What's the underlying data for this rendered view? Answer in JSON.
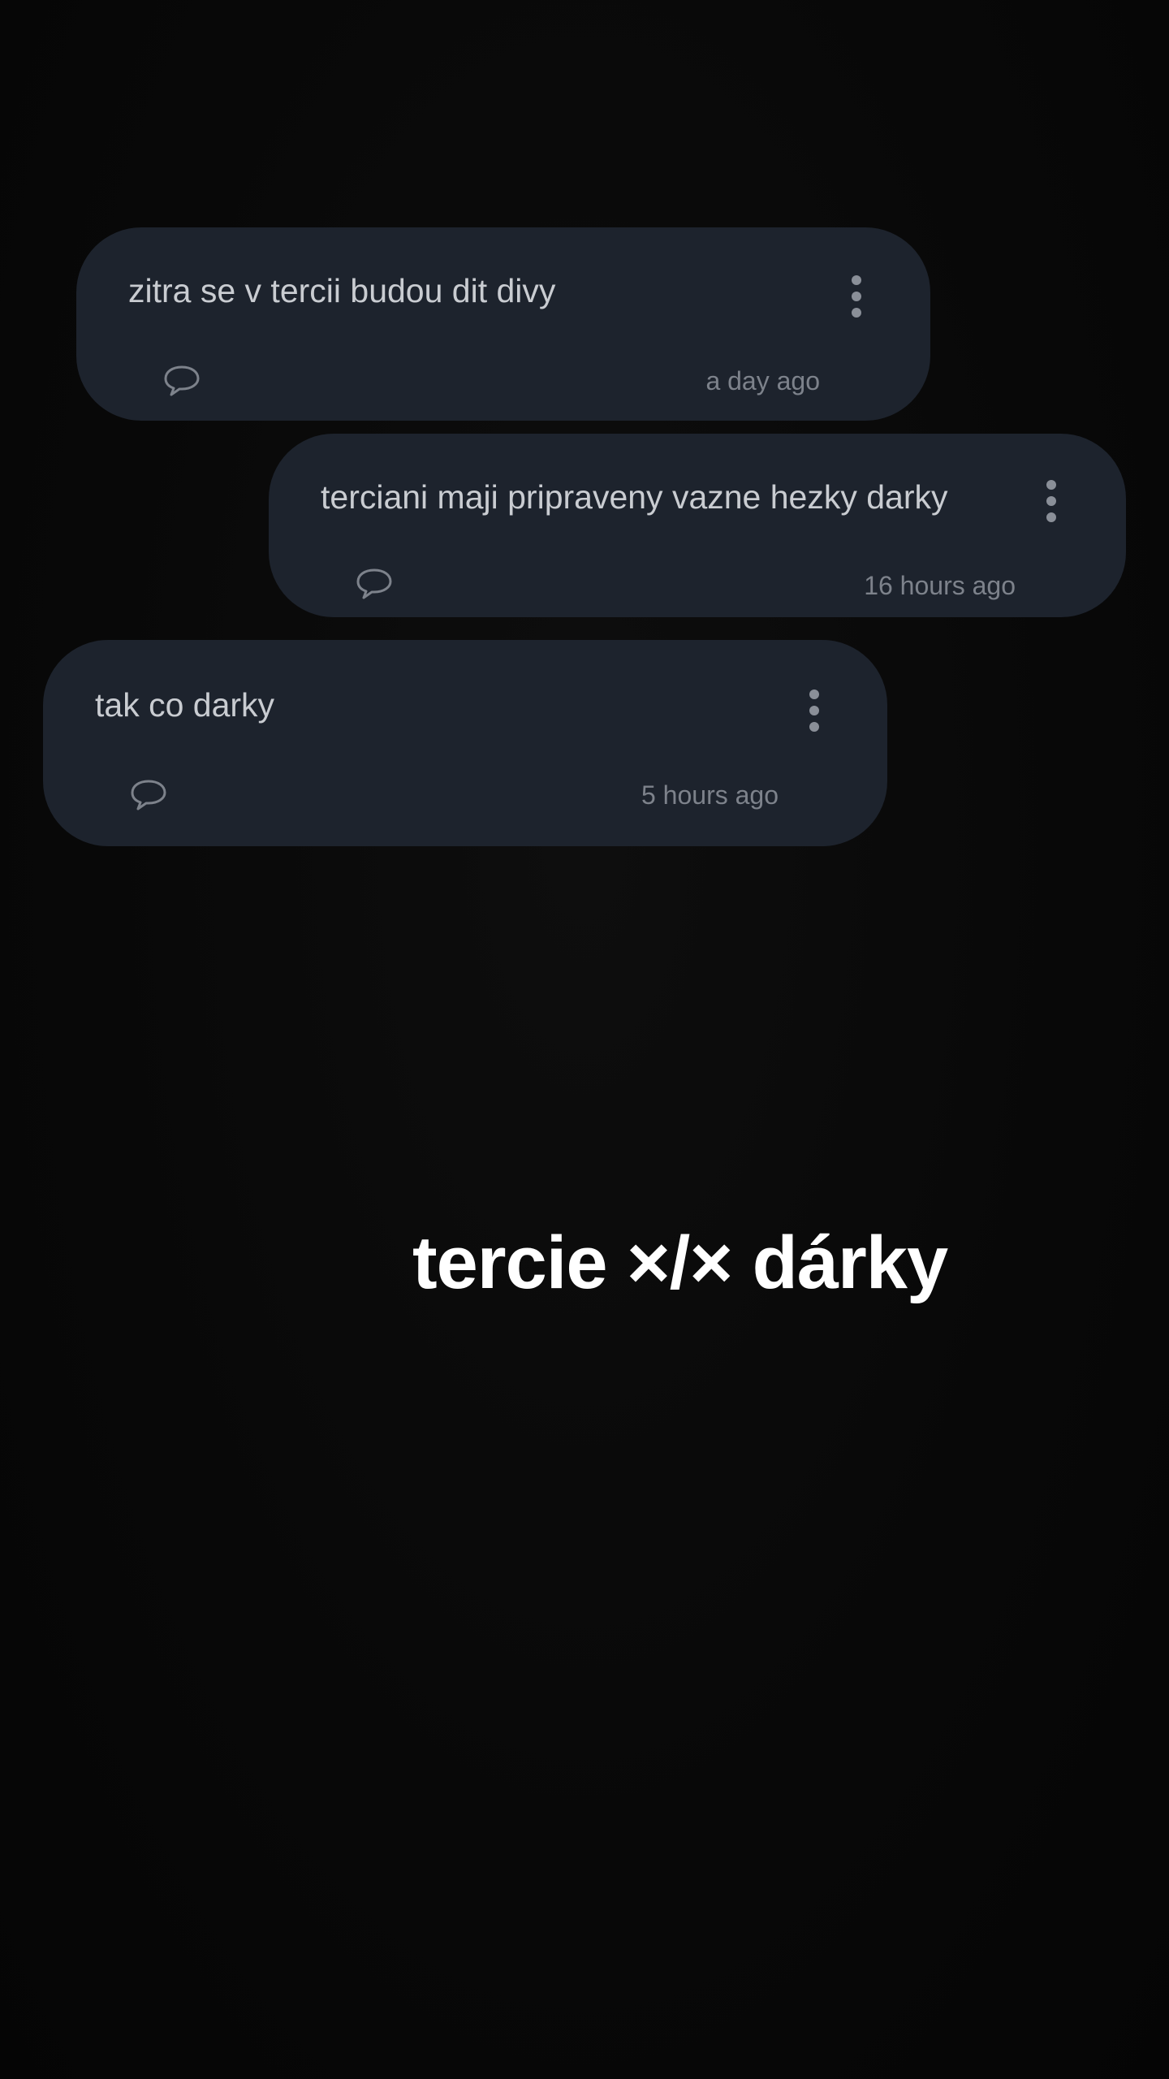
{
  "posts": [
    {
      "text": "zitra se v tercii budou dit divy",
      "time": "a day ago",
      "menu_icon": "more-vertical-icon",
      "comment_icon": "speech-bubble-icon"
    },
    {
      "text": "terciani maji pripraveny vazne hezky darky",
      "time": "16 hours ago",
      "menu_icon": "more-vertical-icon",
      "comment_icon": "speech-bubble-icon"
    },
    {
      "text": "tak co darky",
      "time": "5 hours ago",
      "menu_icon": "more-vertical-icon",
      "comment_icon": "speech-bubble-icon"
    }
  ],
  "overlay": {
    "title": "tercie ×/× dárky"
  },
  "colors": {
    "background": "#070707",
    "card": "#1d232d",
    "text": "#c9ccd1",
    "muted": "#7d828b",
    "overlay_text": "#ffffff"
  }
}
